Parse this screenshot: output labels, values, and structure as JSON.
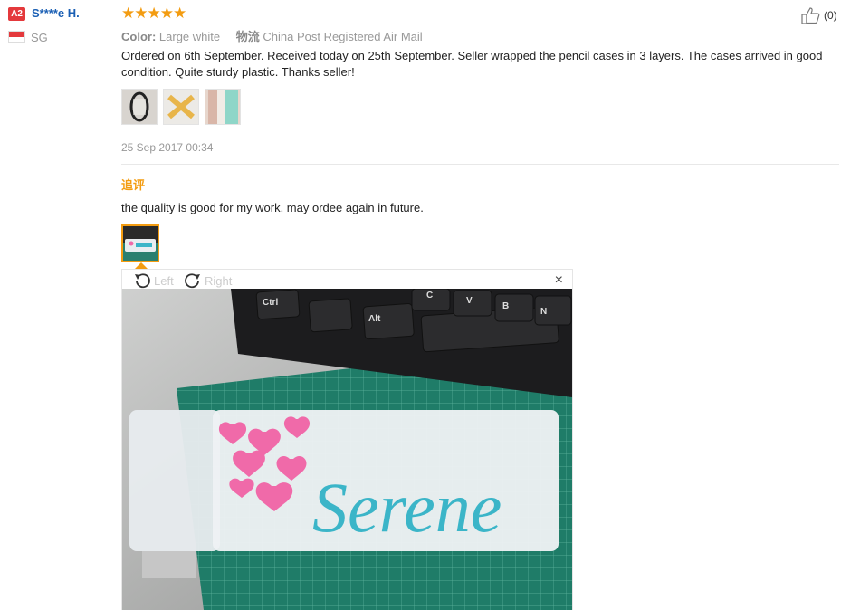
{
  "reviewer": {
    "level_badge": "A2",
    "name": "S****e H.",
    "country": "SG"
  },
  "review": {
    "stars": "★★★★★",
    "rating": 5,
    "helpful_count": "(0)",
    "color_label": "Color:",
    "color_value": "Large white",
    "shipping_label": "物流",
    "shipping_value": "China Post Registered Air Mail",
    "text": "Ordered on 6th September. Received today on 25th September. Seller wrapped the pencil cases in 3 layers. The cases arrived in good condition. Quite sturdy plastic. Thanks seller!",
    "date": "25 Sep 2017 00:34"
  },
  "followup": {
    "label": "追评",
    "text": "the quality is good for my work. may ordee again in future."
  },
  "viewer": {
    "rotate_left": "Left",
    "rotate_right": "Right",
    "close": "×",
    "keys": [
      "Ctrl",
      "Alt",
      "C",
      "V",
      "B",
      "N"
    ],
    "photo_text": "Serene"
  },
  "colors": {
    "accent": "#f39c11",
    "link": "#1a5fb4",
    "badge": "#e4393c",
    "teal_text": "#3bb5c8",
    "pink": "#f06aa9"
  }
}
